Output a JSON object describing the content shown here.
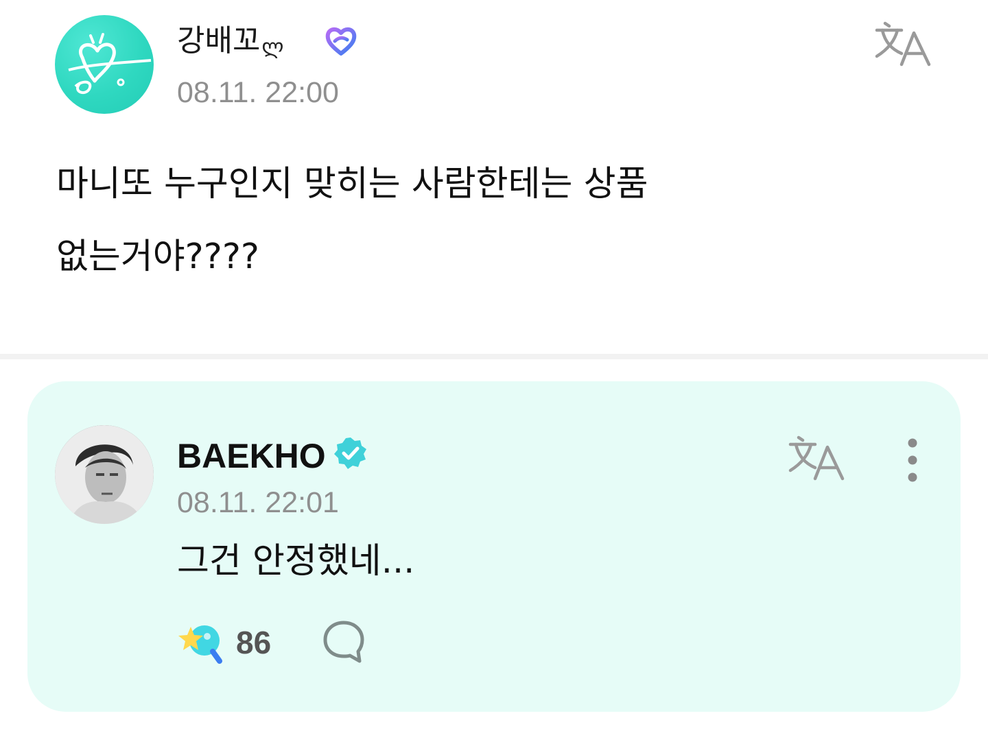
{
  "post": {
    "author_name": "강배꼬",
    "author_name_deco": "ლ",
    "timestamp": "08.11. 22:00",
    "body": "마니또 누구인지 맞히는 사람한테는 상품\n없는거야????"
  },
  "reply": {
    "author_name": "BAEKHO",
    "timestamp": "08.11. 22:01",
    "body": "그건 안정했네...",
    "reaction_count": "86"
  },
  "icons": {
    "translate": "translate-icon",
    "more": "more-vertical-icon",
    "comment": "comment-icon",
    "reaction": "star-lightstick-icon",
    "heart_badge": "heart-badge-icon",
    "verified": "verified-badge-icon"
  },
  "colors": {
    "accent_mint": "#2fd8c0",
    "reply_bg": "#e6fcf7",
    "verified": "#3fd1d9",
    "timestamp": "#8f8f8f"
  }
}
